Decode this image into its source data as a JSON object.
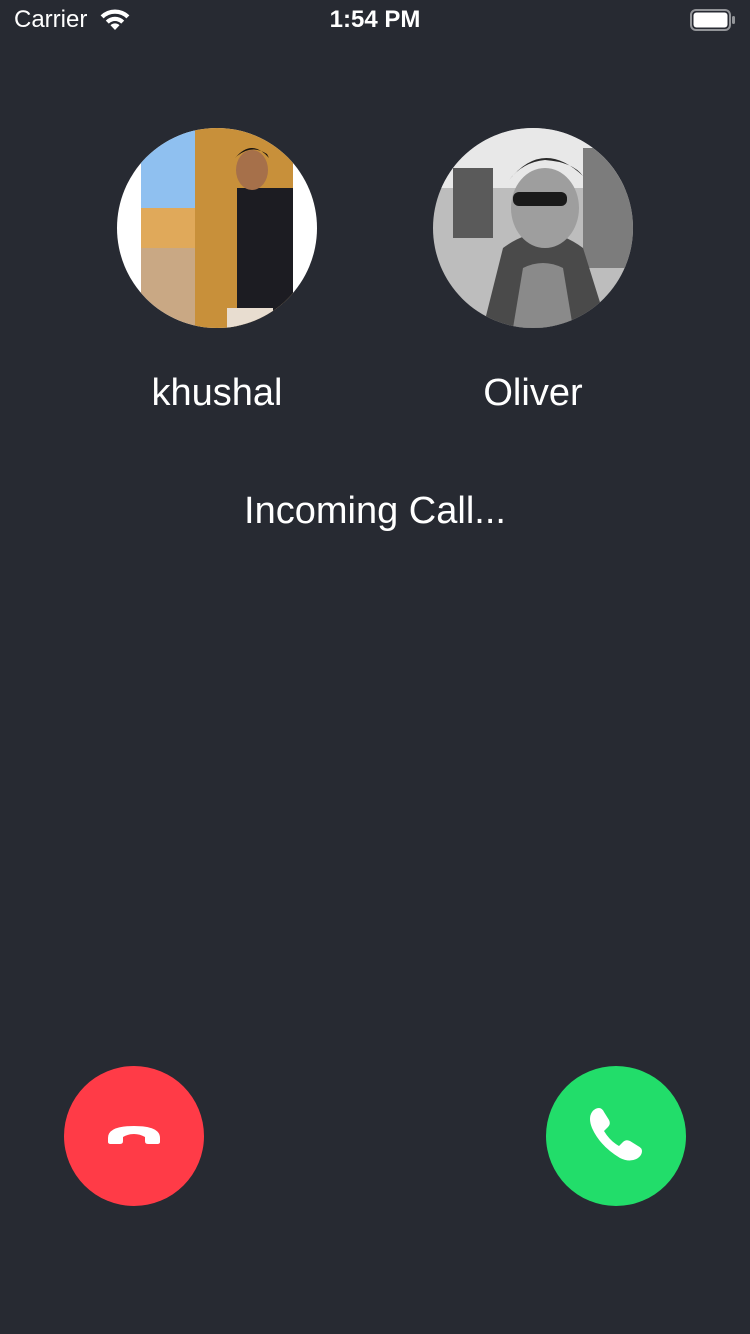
{
  "status_bar": {
    "carrier": "Carrier",
    "time": "1:54 PM",
    "wifi_icon": "wifi-icon",
    "battery_icon": "battery-icon"
  },
  "participants": [
    {
      "name": "khushal",
      "avatar_icon": "avatar-photo"
    },
    {
      "name": "Oliver",
      "avatar_icon": "avatar-photo"
    }
  ],
  "call": {
    "status_text": "Incoming Call...",
    "decline_icon": "phone-hangup-icon",
    "accept_icon": "phone-icon"
  },
  "colors": {
    "background": "#272a32",
    "decline": "#ff3b47",
    "accept": "#22dd6a",
    "text": "#ffffff"
  }
}
